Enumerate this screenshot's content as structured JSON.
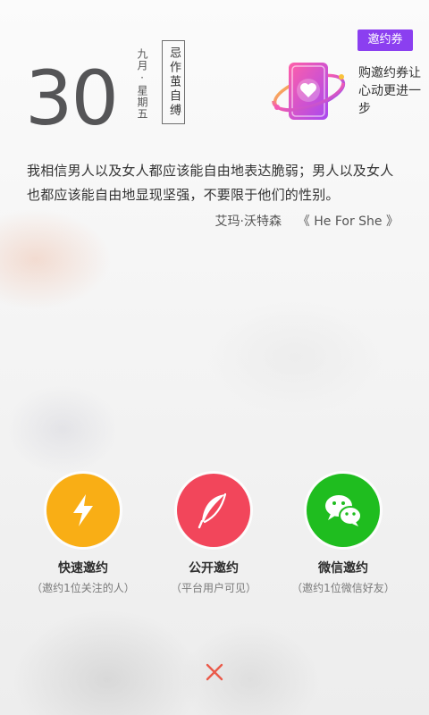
{
  "date": {
    "day": "30",
    "month_weekday": "九月·星期五",
    "almanac": "忌作茧自缚"
  },
  "coupon": {
    "badge": "邀约券",
    "description": "购邀约券让心动更进一步"
  },
  "quote": {
    "text": "我相信男人以及女人都应该能自由地表达脆弱；男人以及女人也都应该能自由地显现坚强，不要限于他们的性别。",
    "author": "艾玛·沃特森",
    "source": "《 He For She 》"
  },
  "actions": [
    {
      "label": "快速邀约",
      "sub": "（邀约1位关注的人）",
      "color": "#f9ae15",
      "icon": "lightning-icon"
    },
    {
      "label": "公开邀约",
      "sub": "（平台用户可见）",
      "color": "#f2465b",
      "icon": "feather-icon"
    },
    {
      "label": "微信邀约",
      "sub": "（邀约1位微信好友）",
      "color": "#1fbd1f",
      "icon": "wechat-icon"
    }
  ],
  "close": {
    "icon": "close-icon",
    "color": "#ea5a4a"
  }
}
